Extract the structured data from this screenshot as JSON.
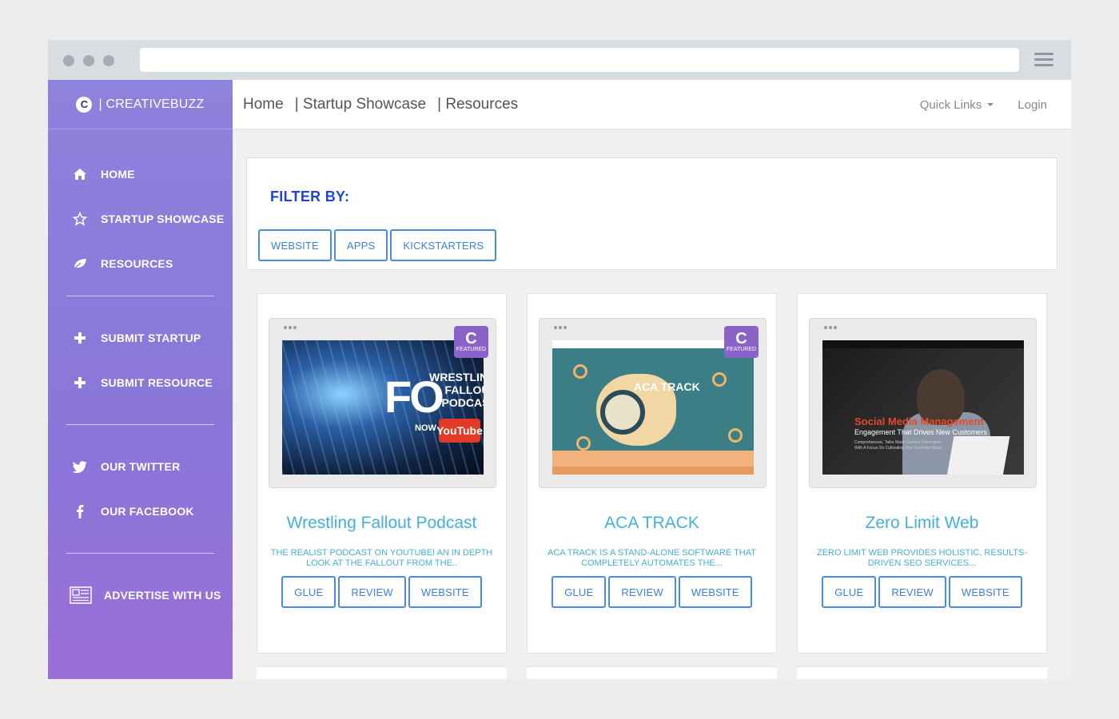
{
  "brand": {
    "logo_letter": "C",
    "name": "| CREATIVEBUZZ"
  },
  "sidebar": {
    "items": [
      {
        "label": "HOME",
        "icon": "home-icon"
      },
      {
        "label": "STARTUP SHOWCASE",
        "icon": "star-icon"
      },
      {
        "label": "RESOURCES",
        "icon": "leaf-icon"
      },
      {
        "label": "SUBMIT STARTUP",
        "icon": "plus-icon"
      },
      {
        "label": "SUBMIT RESOURCE",
        "icon": "plus-icon"
      },
      {
        "label": "OUR TWITTER",
        "icon": "twitter-icon"
      },
      {
        "label": "OUR FACEBOOK",
        "icon": "facebook-icon"
      },
      {
        "label": "ADVERTISE WITH US",
        "icon": "newspaper-icon"
      }
    ]
  },
  "topnav": {
    "links": [
      "Home",
      "| Startup Showcase",
      "| Resources"
    ],
    "quick_links": "Quick Links",
    "login": "Login"
  },
  "filter": {
    "title": "FILTER BY:",
    "buttons": [
      "WEBSITE",
      "APPS",
      "KICKSTARTERS"
    ]
  },
  "cards": [
    {
      "title": "Wrestling Fallout Podcast",
      "description": "THE REALIST PODCAST ON YOUTUBE! AN IN DEPTH LOOK AT THE FALLOUT FROM THE..",
      "featured": true,
      "badge_letter": "C",
      "badge_text": "FEATURED",
      "thumb": {
        "big": "FO",
        "line1": "WRESTLING",
        "line2": "FALLOUT",
        "line3": "PODCAST",
        "now_on": "NOW ON",
        "youtube": "YouTube"
      },
      "buttons": [
        "GLUE",
        "REVIEW",
        "WEBSITE"
      ]
    },
    {
      "title": "ACA TRACK",
      "description": "ACA TRACK IS A STAND-ALONE SOFTWARE THAT COMPLETELY AUTOMATES THE...",
      "featured": true,
      "badge_letter": "C",
      "badge_text": "FEATURED",
      "thumb": {
        "heading": "ACA TRACK"
      },
      "buttons": [
        "GLUE",
        "REVIEW",
        "WEBSITE"
      ]
    },
    {
      "title": "Zero Limit Web",
      "description": "ZERO LIMIT WEB PROVIDES HOLISTIC, RESULTS-DRIVEN SEO SERVICES...",
      "featured": false,
      "thumb": {
        "heading": "Social Media Management",
        "sub": "Engagement That Drives New Customers",
        "small1": "Comprehensive, Tailor Made Content Generation",
        "small2": "With A Focus On Cultivating Your Customer Base"
      },
      "buttons": [
        "GLUE",
        "REVIEW",
        "WEBSITE"
      ]
    }
  ],
  "colors": {
    "sidebar": "#8e82dc",
    "accent": "#3d7fdb",
    "title": "#45b0d8",
    "filter_title": "#2244d0",
    "badge": "#8a63c8"
  }
}
